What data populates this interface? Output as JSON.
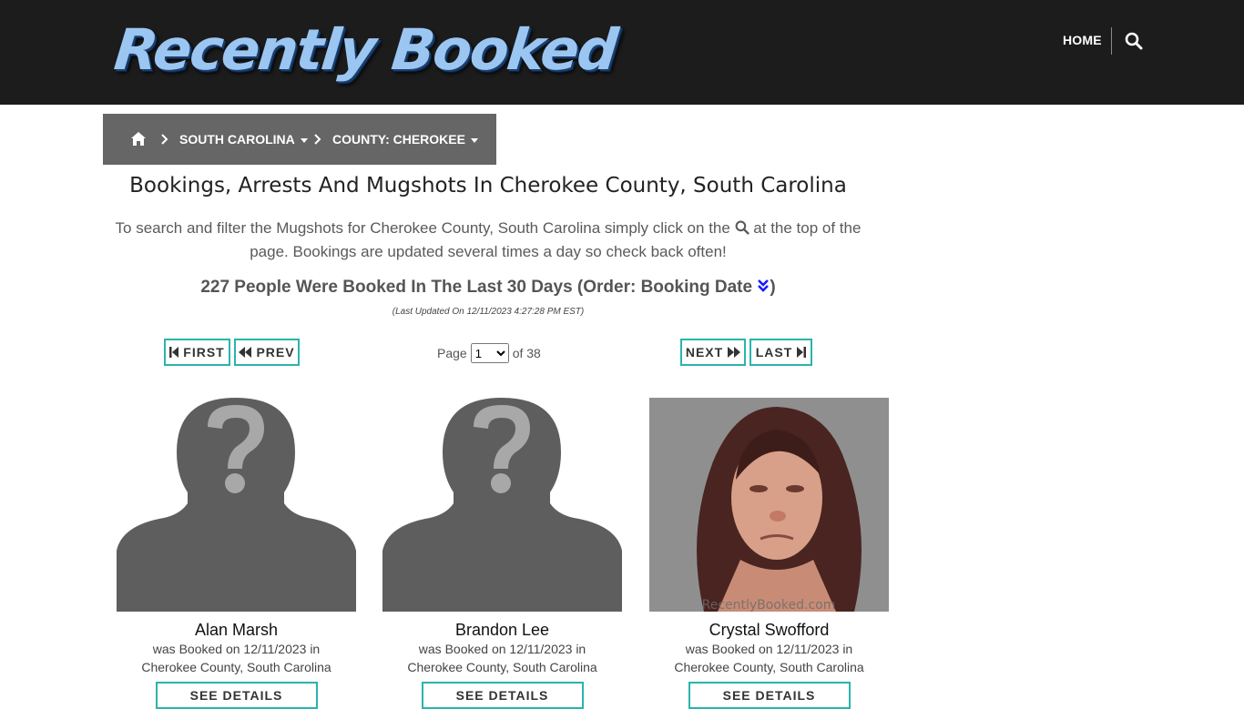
{
  "header": {
    "logo_text": "Recently Booked",
    "nav_home": "HOME",
    "search_icon": "search-icon"
  },
  "breadcrumb": {
    "home_icon": "home-icon",
    "state": "SOUTH CAROLINA",
    "county": "COUNTY: CHEROKEE"
  },
  "page": {
    "title": "Bookings, Arrests And Mugshots In Cherokee County, South Carolina",
    "intro_before": "To search and filter the Mugshots for Cherokee County, South Carolina simply click on the",
    "intro_after": "at the top of the page. Bookings are updated several times a day so check back often!",
    "count_text": "227 People Were Booked In The Last 30 Days (Order: Booking Date",
    "count_close": ")",
    "last_updated": "(Last Updated On 12/11/2023 4:27:28 PM EST)"
  },
  "pagination": {
    "first": "FIRST",
    "prev": "PREV",
    "page_label": "Page",
    "current_page": "1",
    "of_label": "of 38",
    "next": "NEXT",
    "last": "LAST"
  },
  "cards": [
    {
      "name": "Alan Marsh",
      "line1": "was Booked on 12/11/2023 in",
      "line2": "Cherokee County, South Carolina",
      "button": "SEE DETAILS",
      "photo": "placeholder-silhouette"
    },
    {
      "name": "Brandon Lee",
      "line1": "was Booked on 12/11/2023 in",
      "line2": "Cherokee County, South Carolina",
      "button": "SEE DETAILS",
      "photo": "placeholder-silhouette"
    },
    {
      "name": "Crystal Swofford",
      "line1": "was Booked on 12/11/2023 in",
      "line2": "Cherokee County, South Carolina",
      "button": "SEE DETAILS",
      "photo": "mugshot",
      "photo_watermark": "RecentlyBooked.com"
    }
  ],
  "colors": {
    "header_bg": "#1c1c1c",
    "breadcrumb_bg": "#666666",
    "button_border": "#29b4ad",
    "order_icon": "#1a1aff"
  }
}
